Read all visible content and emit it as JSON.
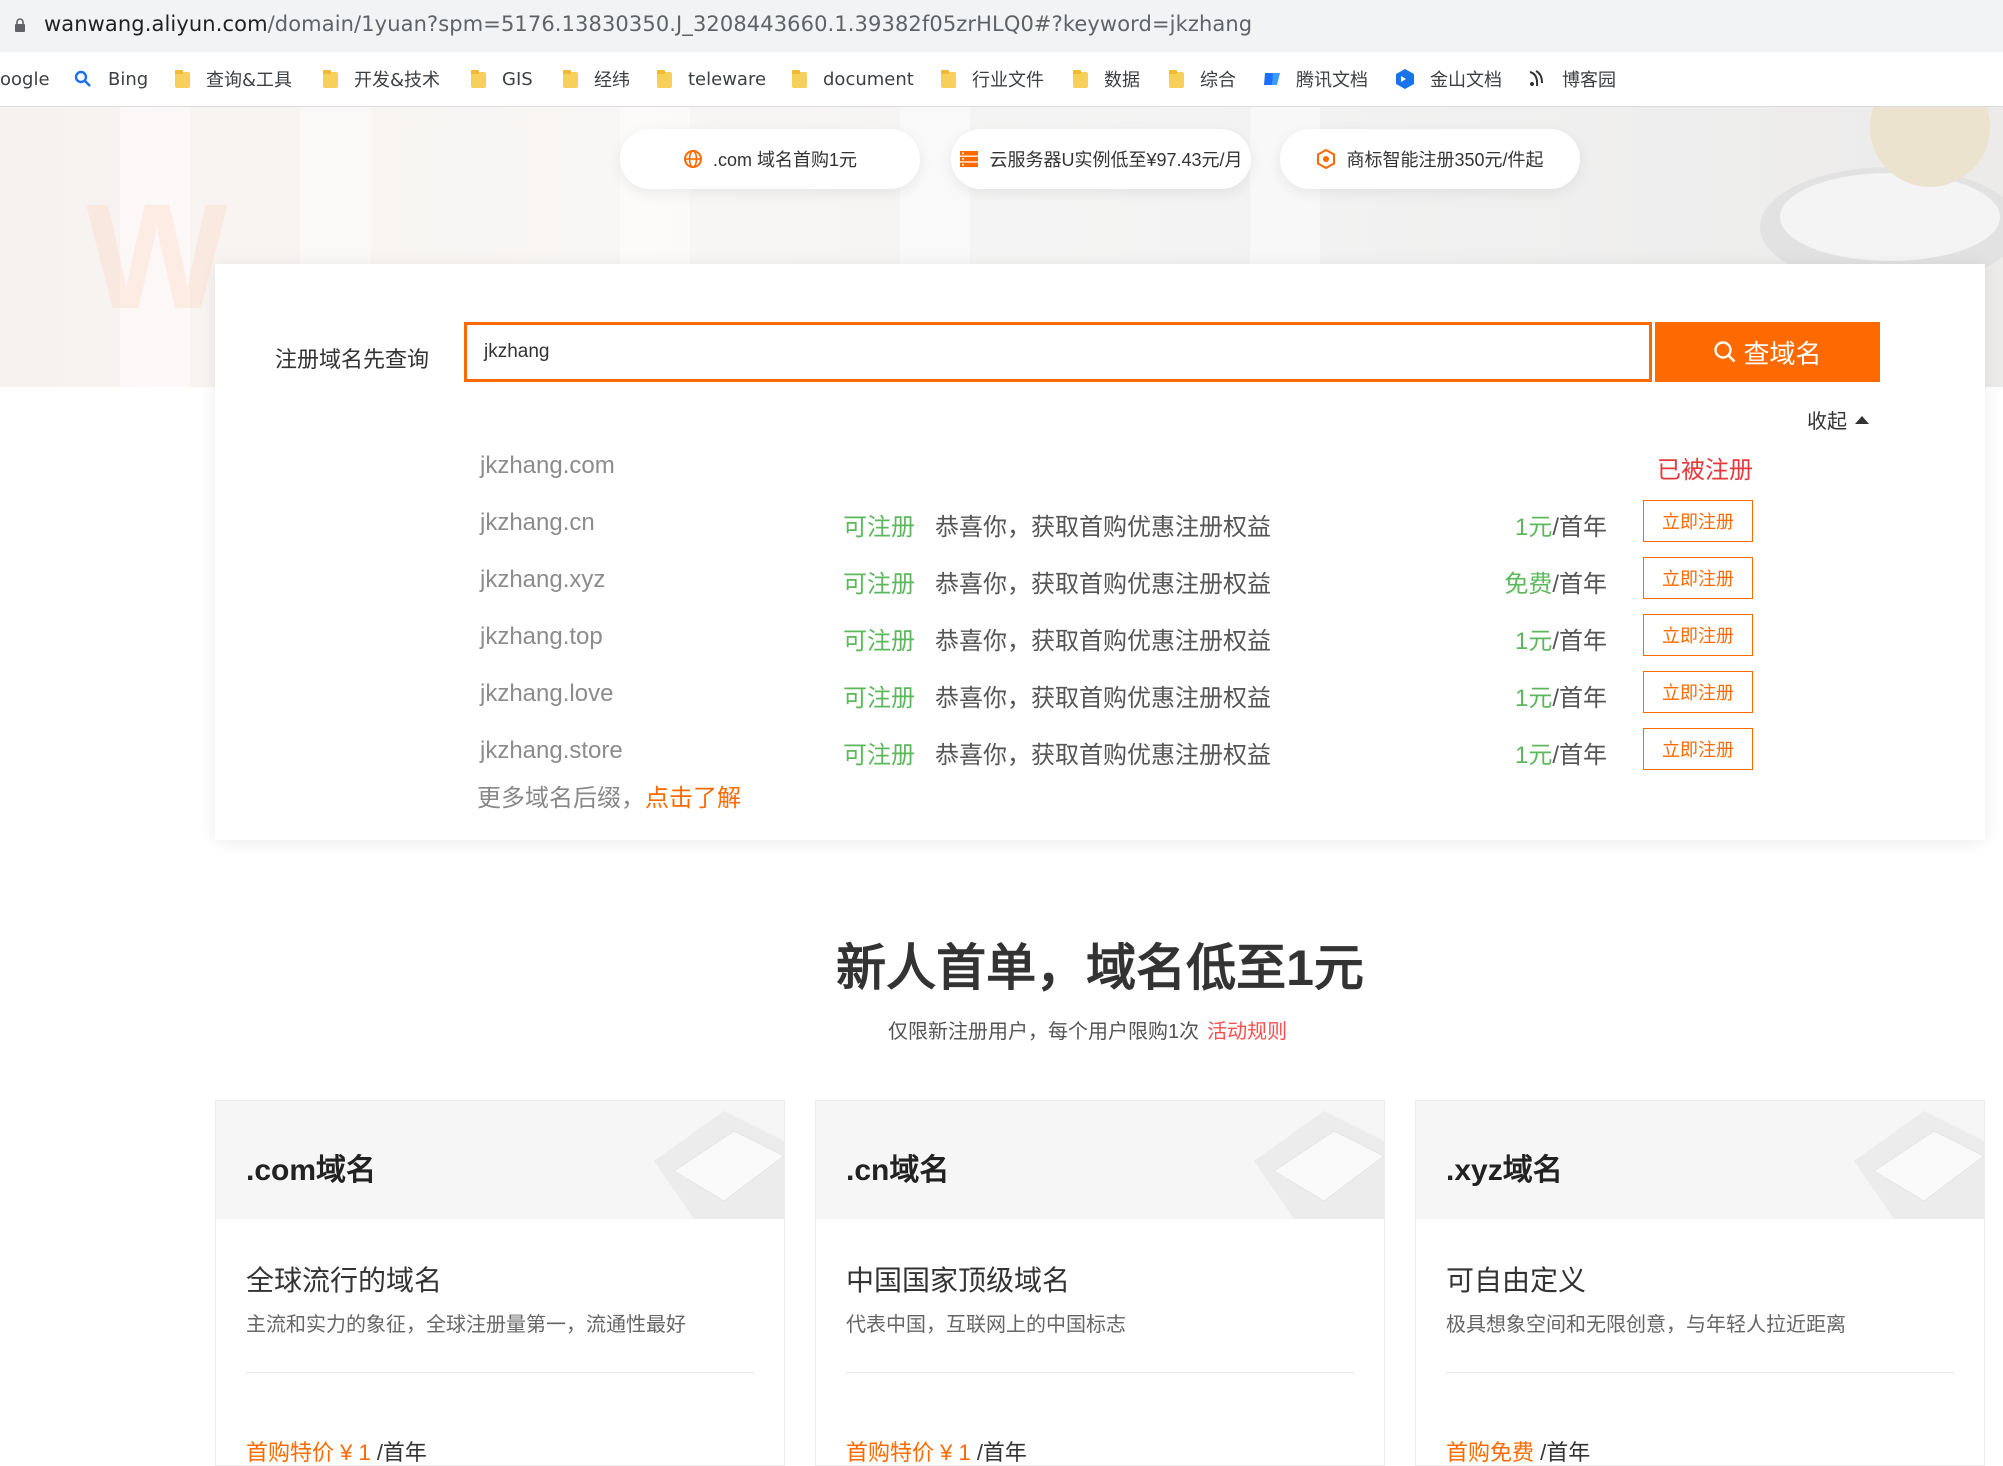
{
  "browser": {
    "url_host": "wanwang.aliyun.com",
    "url_path": "/domain/1yuan?spm=5176.13830350.J_3208443660.1.39382f05zrHLQ0#?keyword=jkzhang"
  },
  "bookmarks": [
    {
      "label": "oogle",
      "icon": "google-icon"
    },
    {
      "label": "Bing",
      "icon": "search-icon"
    },
    {
      "label": "查询&工具",
      "icon": "folder-icon"
    },
    {
      "label": "开发&技术",
      "icon": "folder-icon"
    },
    {
      "label": "GIS",
      "icon": "folder-icon"
    },
    {
      "label": "经纬",
      "icon": "folder-icon"
    },
    {
      "label": "teleware",
      "icon": "folder-icon"
    },
    {
      "label": "document",
      "icon": "folder-icon"
    },
    {
      "label": "行业文件",
      "icon": "folder-icon"
    },
    {
      "label": "数据",
      "icon": "folder-icon"
    },
    {
      "label": "综合",
      "icon": "folder-icon"
    },
    {
      "label": "腾讯文档",
      "icon": "tencent-docs-icon"
    },
    {
      "label": "金山文档",
      "icon": "kingsoft-docs-icon"
    },
    {
      "label": "博客园",
      "icon": "cnblogs-icon"
    }
  ],
  "promos": [
    {
      "label": ".com 域名首购1元",
      "icon": "globe-icon"
    },
    {
      "label": "云服务器U实例低至¥97.43元/月",
      "icon": "server-icon"
    },
    {
      "label": "商标智能注册350元/件起",
      "icon": "trademark-icon"
    }
  ],
  "search": {
    "label": "注册域名先查询",
    "value": "jkzhang",
    "button": "查域名",
    "collapse": "收起"
  },
  "results": [
    {
      "domain": "jkzhang.com",
      "taken": "已被注册"
    },
    {
      "domain": "jkzhang.cn",
      "status": "可注册",
      "message": "恭喜你，获取首购优惠注册权益",
      "price": "1元",
      "unit": "/首年",
      "action": "立即注册"
    },
    {
      "domain": "jkzhang.xyz",
      "status": "可注册",
      "message": "恭喜你，获取首购优惠注册权益",
      "price": "免费",
      "unit": "/首年",
      "action": "立即注册"
    },
    {
      "domain": "jkzhang.top",
      "status": "可注册",
      "message": "恭喜你，获取首购优惠注册权益",
      "price": "1元",
      "unit": "/首年",
      "action": "立即注册"
    },
    {
      "domain": "jkzhang.love",
      "status": "可注册",
      "message": "恭喜你，获取首购优惠注册权益",
      "price": "1元",
      "unit": "/首年",
      "action": "立即注册"
    },
    {
      "domain": "jkzhang.store",
      "status": "可注册",
      "message": "恭喜你，获取首购优惠注册权益",
      "price": "1元",
      "unit": "/首年",
      "action": "立即注册"
    }
  ],
  "more": {
    "text": "更多域名后缀，",
    "link": "点击了解"
  },
  "section": {
    "title": "新人首单，域名低至1元",
    "subtitle": "仅限新注册用户，每个用户限购1次",
    "rules": "活动规则"
  },
  "cards": [
    {
      "title": ".com域名",
      "name": "全球流行的域名",
      "desc": "主流和实力的象征，全球注册量第一，流通性最好",
      "price": "首购特价 ¥ 1",
      "unit": " /首年"
    },
    {
      "title": ".cn域名",
      "name": "中国国家顶级域名",
      "desc": "代表中国，互联网上的中国标志",
      "price": "首购特价 ¥ 1",
      "unit": " /首年"
    },
    {
      "title": ".xyz域名",
      "name": "可自由定义",
      "desc": "极具想象空间和无限创意，与年轻人拉近距离",
      "price": "首购免费",
      "unit": " /首年"
    }
  ],
  "colors": {
    "accent": "#ff6a00",
    "available": "#5cb85c",
    "taken": "#e4393c"
  }
}
